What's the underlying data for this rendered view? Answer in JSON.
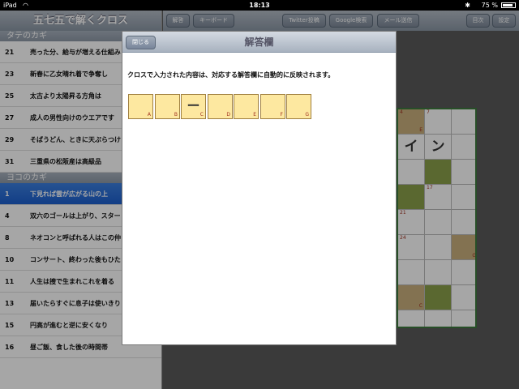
{
  "status": {
    "device": "iPad",
    "time": "18:13",
    "battery": "75 %"
  },
  "app": {
    "title": "五七五で解くクロス"
  },
  "sections": {
    "tate": "タテのカギ",
    "yoko": "ヨコのカギ"
  },
  "tate_clues": [
    {
      "num": "21",
      "text": "売った分、給与が増える仕組み"
    },
    {
      "num": "23",
      "text": "新春に乙女晴れ着で争奪し"
    },
    {
      "num": "25",
      "text": "太古より太陽昇る方角は"
    },
    {
      "num": "27",
      "text": "成人の男性向けのウエアです"
    },
    {
      "num": "29",
      "text": "そばうどん、ときに天ぷらつけ"
    },
    {
      "num": "31",
      "text": "三重県の松阪産は高級品"
    }
  ],
  "yoko_clues": [
    {
      "num": "1",
      "text": "下見れば雲が広がる山の上",
      "selected": true
    },
    {
      "num": "4",
      "text": "双六のゴールは上がり、スター"
    },
    {
      "num": "8",
      "text": "ネオコンと呼ばれる人はこの仲"
    },
    {
      "num": "10",
      "text": "コンサート、終わった後もひた"
    },
    {
      "num": "11",
      "text": "人生は捜で生まれこれを着る"
    },
    {
      "num": "13",
      "text": "届いたらすぐに息子は使いきり"
    },
    {
      "num": "15",
      "text": "円高が進むと逆に安くなり"
    },
    {
      "num": "16",
      "text": "昼ご飯、食した後の時間帯"
    }
  ],
  "toolbar": {
    "answer": "解答",
    "keyboard": "キーボード",
    "twitter": "Twitter投稿",
    "google": "Google検索",
    "mail": "メール送信",
    "toc": "目次",
    "settings": "設定"
  },
  "grid": {
    "n4": "4",
    "l_e": "E",
    "n7": "7",
    "big1": "イ",
    "big2": "ン",
    "n17": "17",
    "n21": "21",
    "n24": "24",
    "l_g": "G",
    "l_c": "C"
  },
  "modal": {
    "close": "閉じる",
    "title": "解答欄",
    "description": "クロスで入力された内容は、対応する解答欄に自動的に反映されます。",
    "boxes": [
      {
        "char": "",
        "key": "A"
      },
      {
        "char": "",
        "key": "B"
      },
      {
        "char": "ー",
        "key": "C"
      },
      {
        "char": "",
        "key": "D"
      },
      {
        "char": "",
        "key": "E"
      },
      {
        "char": "",
        "key": "F"
      },
      {
        "char": "",
        "key": "G"
      }
    ]
  }
}
